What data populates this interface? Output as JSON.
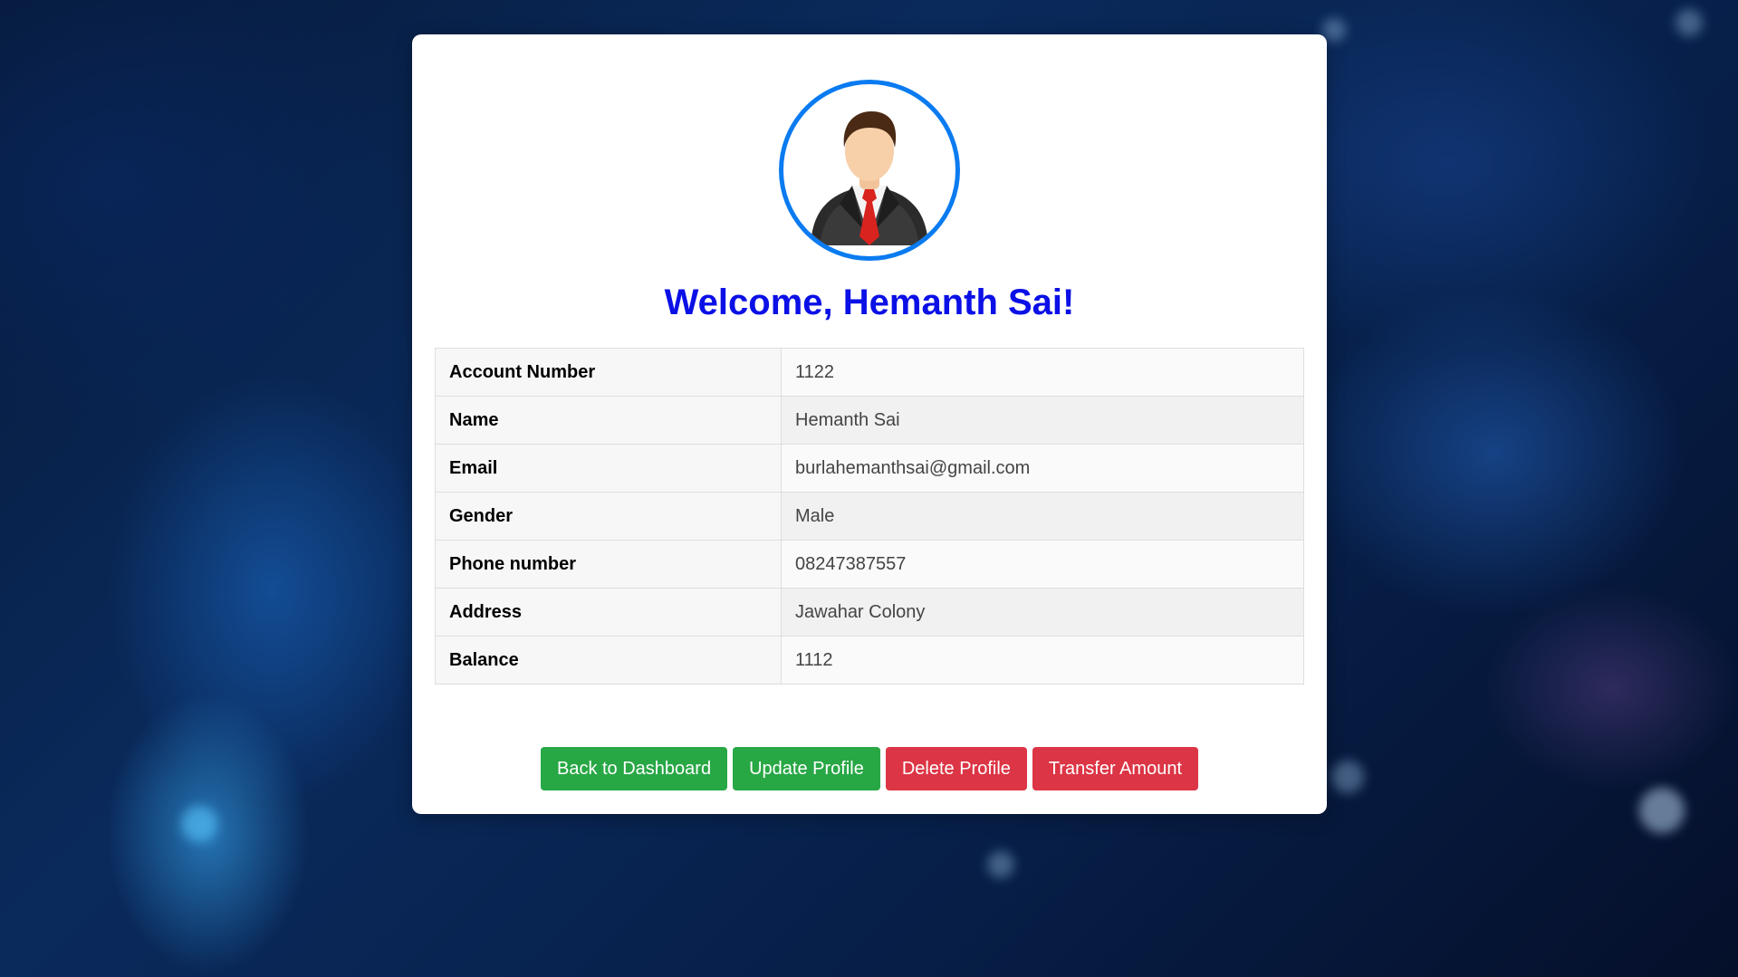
{
  "profile": {
    "welcome": "Welcome, Hemanth Sai!",
    "avatar_icon": "businessman-avatar-icon",
    "fields": [
      {
        "label": "Account Number",
        "value": "1122"
      },
      {
        "label": "Name",
        "value": "Hemanth Sai"
      },
      {
        "label": "Email",
        "value": "burlahemanthsai@gmail.com"
      },
      {
        "label": "Gender",
        "value": "Male"
      },
      {
        "label": "Phone number",
        "value": "08247387557"
      },
      {
        "label": "Address",
        "value": "Jawahar Colony"
      },
      {
        "label": "Balance",
        "value": "1112"
      }
    ]
  },
  "actions": {
    "back": "Back to Dashboard",
    "update": "Update Profile",
    "delete": "Delete Profile",
    "transfer": "Transfer Amount"
  },
  "colors": {
    "heading": "#0b10e6",
    "avatar_border": "#0a7bf0",
    "success": "#28a745",
    "danger": "#dc3545"
  }
}
